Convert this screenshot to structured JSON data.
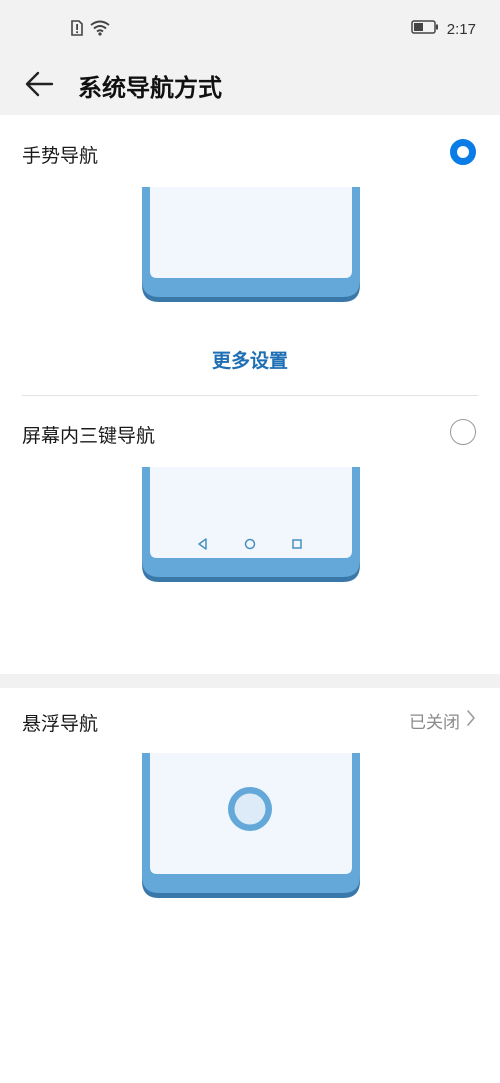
{
  "status_bar": {
    "time": "2:17"
  },
  "header": {
    "title": "系统导航方式"
  },
  "options": {
    "gesture": {
      "label": "手势导航",
      "selected": true,
      "more_settings": "更多设置"
    },
    "three_key": {
      "label": "屏幕内三键导航",
      "selected": false
    },
    "floating": {
      "label": "悬浮导航",
      "status": "已关闭"
    }
  },
  "colors": {
    "accent": "#0a7ce8",
    "link": "#1f6fb5",
    "phone_frame": "#63a8d8",
    "phone_screen": "#f1f7fc"
  }
}
